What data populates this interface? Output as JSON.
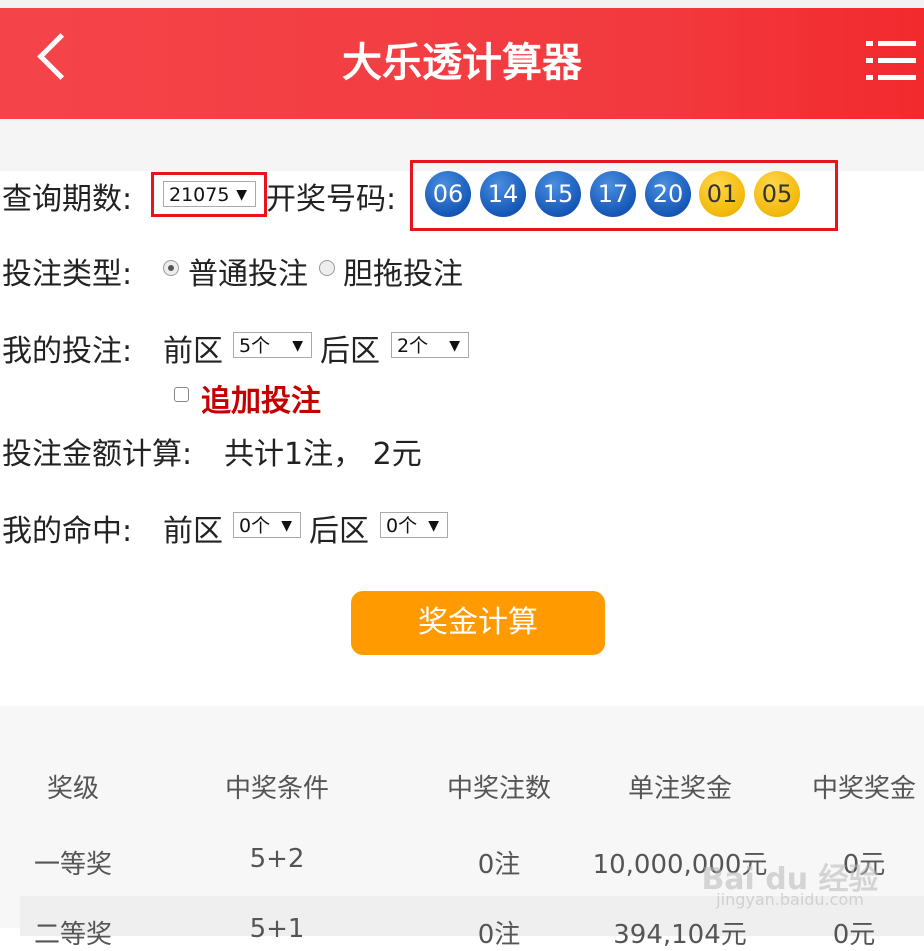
{
  "header": {
    "title": "大乐透计算器",
    "back_icon": "chevron-left-icon",
    "menu_icon": "menu-list-icon"
  },
  "query": {
    "label": "查询期数:",
    "period": "21075",
    "draw_label": "开奖号码:",
    "front_balls": [
      "06",
      "14",
      "15",
      "17",
      "20"
    ],
    "back_balls": [
      "01",
      "05"
    ],
    "front_color": "#1558b8",
    "back_color": "#f2b90a"
  },
  "bet_type": {
    "label": "投注类型:",
    "options": [
      "普通投注",
      "胆拖投注"
    ],
    "selected": "普通投注"
  },
  "my_bet": {
    "label": "我的投注:",
    "front_label": "前区",
    "front_value": "5个",
    "back_label": "后区",
    "back_value": "2个",
    "add_bet_label": "追加投注"
  },
  "amount": {
    "label": "投注金额计算:",
    "text": "共计1注，  2元"
  },
  "my_hits": {
    "label": "我的命中:",
    "front_label": "前区",
    "front_value": "0个",
    "back_label": "后区",
    "back_value": "0个"
  },
  "calc_button": "奖金计算",
  "table": {
    "headers": [
      "奖级",
      "中奖条件",
      "中奖注数",
      "单注奖金",
      "中奖奖金"
    ],
    "rows": [
      [
        "一等奖",
        "5+2",
        "0注",
        "10,000,000元",
        "0元"
      ],
      [
        "二等奖",
        "5+1",
        "0注",
        "394,104元",
        "0元"
      ]
    ]
  },
  "watermark": {
    "brand": "Bai du 经验",
    "url": "jingyan.baidu.com"
  },
  "accent_color": "#f23a3e",
  "button_color": "#ff9a00"
}
